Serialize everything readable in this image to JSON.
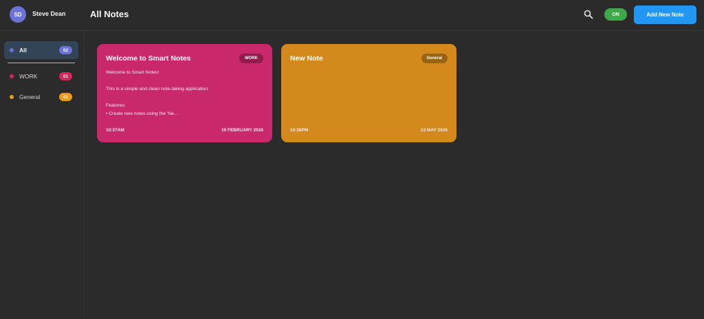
{
  "user": {
    "initials": "SD",
    "name": "Steve Dean"
  },
  "header": {
    "title": "All Notes",
    "search_icon": "search-icon",
    "toggle_label": "ON",
    "add_button_label": "Add New Note"
  },
  "colors": {
    "accent_blue": "#2196f3",
    "toggle_green": "#3ea84a",
    "work": "#c9286a",
    "general": "#d4891c",
    "all": "#6d72d8"
  },
  "sidebar": {
    "items": [
      {
        "label": "All",
        "count": "02",
        "color": "#6d72d8",
        "active": true
      },
      {
        "label": "WORK",
        "count": "01",
        "color": "#d6285f",
        "active": false
      },
      {
        "label": "General",
        "count": "01",
        "color": "#f09a15",
        "active": false
      }
    ]
  },
  "notes": [
    {
      "title": "Welcome to Smart Notes",
      "tag": "WORK",
      "body": "Welcome to Smart Notes!\n\nThis is a simple and clean note-taking application.\n\nFeatures:\n• Create new notes using the 'Ne...",
      "time": "10:37AM",
      "date": "19 FEBRUARY 2026",
      "color": "#c9286a"
    },
    {
      "title": "New Note",
      "tag": "General",
      "body": "",
      "time": "10:38PM",
      "date": "13 MAY 2026",
      "color": "#d4891c"
    }
  ]
}
